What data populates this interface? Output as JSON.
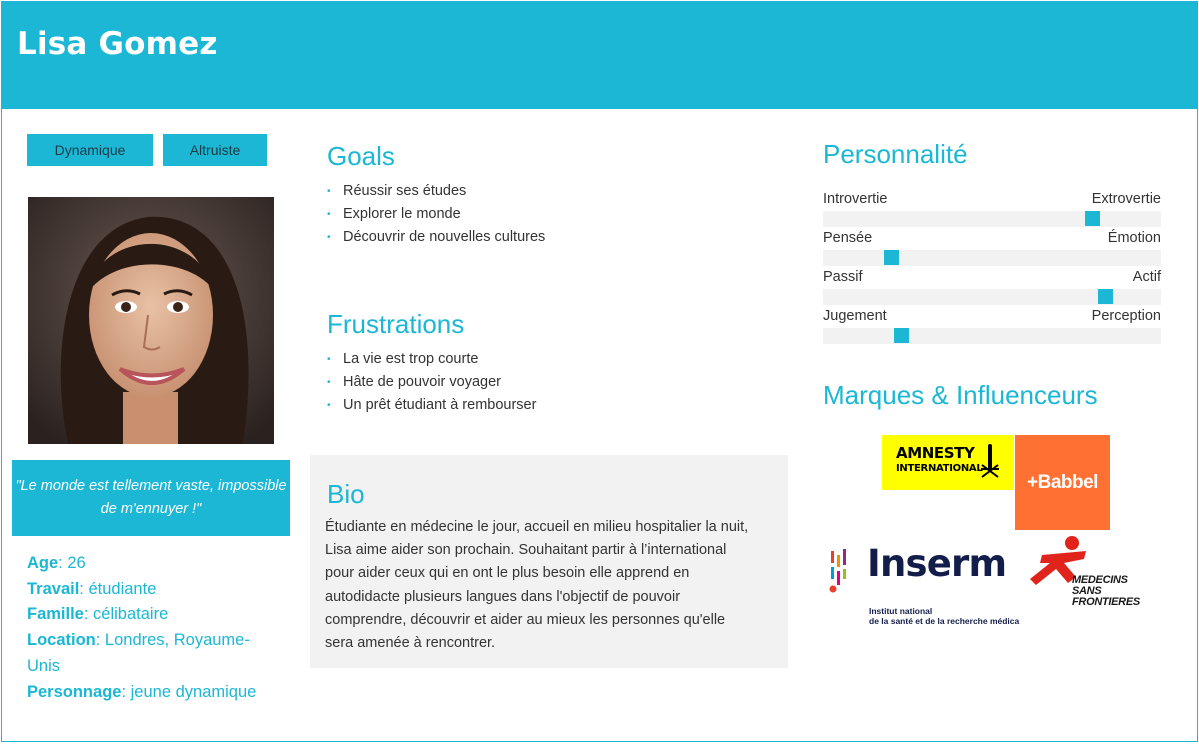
{
  "persona": {
    "name": "Lisa Gomez",
    "tags": [
      "Dynamique",
      "Altruiste"
    ],
    "quote": "\"Le monde est tellement vaste, impossible de m'ennuyer !\"",
    "facts": [
      {
        "label": "Age",
        "value": " 26"
      },
      {
        "label": "Travail",
        "value": " étudiante"
      },
      {
        "label": "Famille",
        "value": " célibataire"
      },
      {
        "label": "Location",
        "value": " Londres, Royaume-Unis"
      },
      {
        "label": "Personnage",
        "value": " jeune dynamique"
      }
    ]
  },
  "goals": {
    "title": "Goals",
    "items": [
      "Réussir ses études",
      "Explorer le monde",
      "Découvrir de nouvelles cultures"
    ]
  },
  "frustrations": {
    "title": "Frustrations",
    "items": [
      "La vie est trop courte",
      "Hâte de pouvoir voyager",
      "Un prêt étudiant à rembourser"
    ]
  },
  "bio": {
    "title": "Bio",
    "text": "Étudiante en médecine le jour, accueil en milieu hospitalier la nuit, Lisa aime aider son prochain. Souhaitant partir à l’international pour aider ceux qui en ont le plus besoin elle apprend en autodidacte plusieurs langues dans l'objectif de pouvoir comprendre, découvrir et aider au mieux les personnes qu'elle sera amenée à rencontrer."
  },
  "personality": {
    "title": "Personnalité",
    "traits": [
      {
        "left": "Introvertie",
        "right": "Extrovertie",
        "level": 0.81
      },
      {
        "left": "Pensée",
        "right": "Émotion",
        "level": 0.19
      },
      {
        "left": "Passif",
        "right": "Actif",
        "level": 0.85
      },
      {
        "left": "Jugement",
        "right": "Perception",
        "level": 0.22
      }
    ]
  },
  "brands": {
    "title": "Marques & Influenceurs",
    "amnesty_line1": "AMNESTY",
    "amnesty_line2": "INTERNATIONAL",
    "babbel": "+Babbel",
    "inserm": "Inserm",
    "inserm_sub1": "Institut national",
    "inserm_sub2": "de la santé et de la recherche médica",
    "msf_line1": "MEDECINS",
    "msf_line2": "SANS FRONTIERES"
  },
  "colors": {
    "accent": "#1bb7d4",
    "panel": "#f2f2f2",
    "amnesty": "#ffff00",
    "babbel": "#ff7033",
    "msf": "#e1241b",
    "inserm": "#131d4a"
  }
}
